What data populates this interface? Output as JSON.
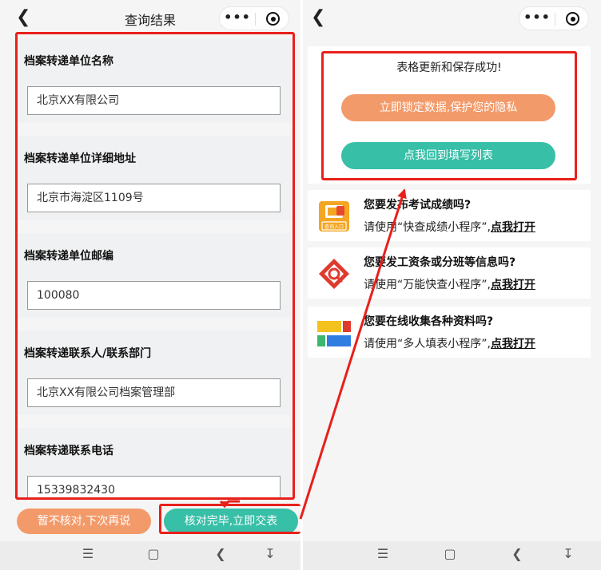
{
  "left_screen": {
    "nav": {
      "back_icon": "chevron-left-icon",
      "title": "查询结果",
      "menu_icon": "more-dots-icon",
      "close_icon": "target-circle-icon"
    },
    "fields": [
      {
        "label": "档案转递单位名称",
        "value": "北京XX有限公司"
      },
      {
        "label": "档案转递单位详细地址",
        "value": "北京市海淀区1109号"
      },
      {
        "label": "档案转递单位邮编",
        "value": "100080"
      },
      {
        "label": "档案转递联系人/联系部门",
        "value": "北京XX有限公司档案管理部"
      },
      {
        "label": "档案转递联系电话",
        "value": "15339832430"
      }
    ],
    "buttons": {
      "later": "暂不核对,下次再说",
      "submit": "核对完毕,立即交表"
    }
  },
  "right_screen": {
    "nav": {
      "back_icon": "chevron-left-icon",
      "menu_icon": "more-dots-icon",
      "close_icon": "target-circle-icon"
    },
    "success": {
      "message": "表格更新和保存成功!",
      "lock_button": "立即锁定数据,保护您的隐私",
      "back_button": "点我回到填写列表"
    },
    "promos": [
      {
        "title": "您要发布考试成绩吗?",
        "desc_prefix": "请使用“快查成绩小程序”,",
        "link": "点我打开",
        "icon": "score-query-icon",
        "icon_text": "查询入口"
      },
      {
        "title": "您要发工资条或分班等信息吗?",
        "desc_prefix": "请使用“万能快查小程序”,",
        "link": "点我打开",
        "icon": "universal-query-icon"
      },
      {
        "title": "您要在线收集各种资料吗?",
        "desc_prefix": "请使用“多人填表小程序”,",
        "link": "点我打开",
        "icon": "multi-form-icon"
      }
    ]
  },
  "system_nav": {
    "menu_icon": "menu-lines-icon",
    "home_icon": "home-square-icon",
    "back_icon": "back-arrow-icon",
    "extra_icon": "download-arrow-icon"
  },
  "colors": {
    "orange": "#f39a6a",
    "teal": "#37bfa7",
    "annotation_red": "#e8201b"
  }
}
